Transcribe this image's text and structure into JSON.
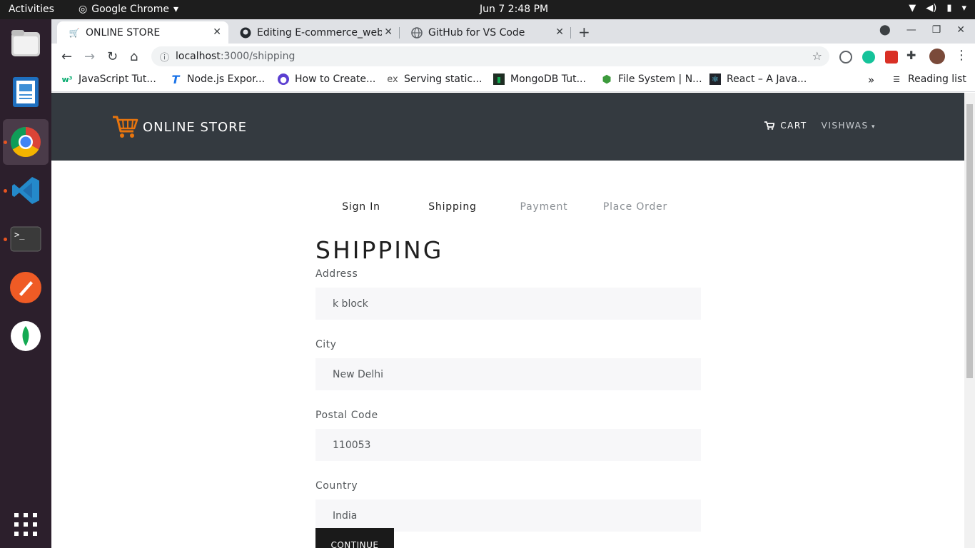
{
  "os": {
    "activities": "Activities",
    "app_name": "Google Chrome",
    "clock": "Jun 7   2:48 PM"
  },
  "browser": {
    "tabs": [
      {
        "title": "ONLINE STORE",
        "active": true
      },
      {
        "title": "Editing E-commerce_web",
        "active": false
      },
      {
        "title": "GitHub for VS Code",
        "active": false
      }
    ],
    "url_host": "localhost",
    "url_path": ":3000/shipping",
    "bookmarks": [
      "JavaScript Tut...",
      "Node.js Expor...",
      "How to Create...",
      "Serving static...",
      "MongoDB Tut...",
      "File System | N...",
      "React – A Java..."
    ],
    "reading_list": "Reading list"
  },
  "site": {
    "brand": "ONLINE STORE",
    "cart_label": "CART",
    "user_label": "VISHWAS",
    "steps": [
      {
        "label": "Sign In",
        "state": "active"
      },
      {
        "label": "Shipping",
        "state": "active"
      },
      {
        "label": "Payment",
        "state": "disabled"
      },
      {
        "label": "Place Order",
        "state": "disabled"
      }
    ],
    "heading": "SHIPPING",
    "fields": [
      {
        "label": "Address",
        "value": "k block"
      },
      {
        "label": "City",
        "value": "New Delhi"
      },
      {
        "label": "Postal Code",
        "value": "110053"
      },
      {
        "label": "Country",
        "value": "India"
      }
    ],
    "continue_label": "CONTINUE"
  },
  "colors": {
    "navbar": "#343a40",
    "brand_accent": "#e8750e",
    "input_bg": "#f7f7f9",
    "button": "#1a1a1a"
  }
}
